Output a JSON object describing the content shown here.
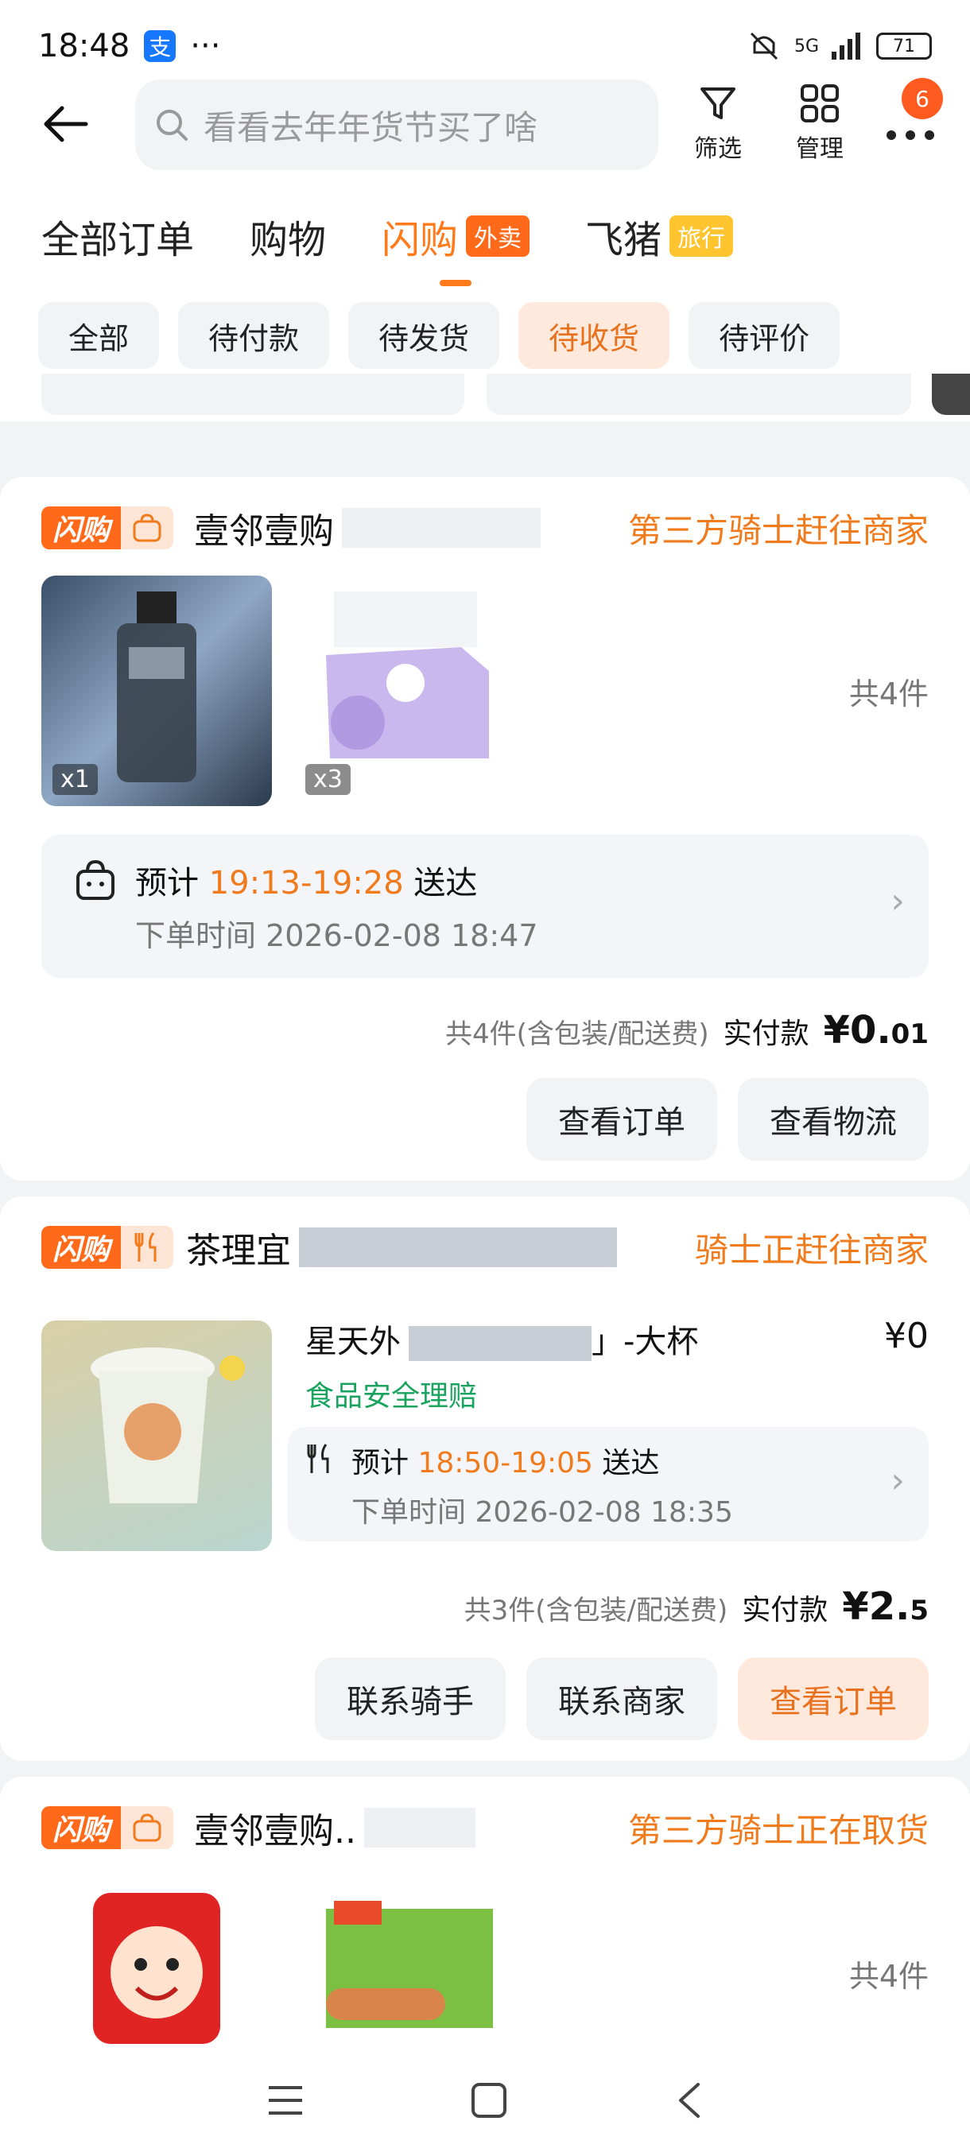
{
  "status_bar": {
    "time": "18:48",
    "dots": "···",
    "network": "5G",
    "battery": "71"
  },
  "header": {
    "search_placeholder": "看看去年年货节买了啥",
    "filter_label": "筛选",
    "manage_label": "管理",
    "more_badge": "6"
  },
  "tabs": [
    {
      "label": "全部订单",
      "tag": ""
    },
    {
      "label": "购物",
      "tag": ""
    },
    {
      "label": "闪购",
      "tag": "外卖"
    },
    {
      "label": "飞猪",
      "tag": "旅行"
    }
  ],
  "filters": [
    "全部",
    "待付款",
    "待发货",
    "待收货",
    "待评价"
  ],
  "active_filter": "待收货",
  "orders": [
    {
      "brand": "闪购",
      "shop": "壹邻壹购",
      "status": "第三方骑士赶往商家",
      "items": [
        {
          "qty": "x1",
          "icon": "lotion-bottle"
        },
        {
          "qty": "x3",
          "icon": "tissue-box"
        }
      ],
      "count": "共4件",
      "eta_prefix": "预计",
      "eta_time": "19:13-19:28",
      "eta_suffix": "送达",
      "order_time": "下单时间 2026-02-08 18:47",
      "summary": "共4件(含包装/配送费)",
      "paid_label": "实付款",
      "amount_main": "¥0.",
      "amount_dec": "01",
      "buttons": [
        "查看订单",
        "查看物流"
      ]
    },
    {
      "brand": "闪购",
      "shop": "茶理宜",
      "status": "骑士正赶往商家",
      "product_title": "星天外",
      "product_title_tail": "」-大杯",
      "price": "¥0",
      "safety": "食品安全理赔",
      "eta_prefix": "预计",
      "eta_time": "18:50-19:05",
      "eta_suffix": "送达",
      "order_time": "下单时间 2026-02-08 18:35",
      "summary": "共3件(含包装/配送费)",
      "paid_label": "实付款",
      "amount_main": "¥2.",
      "amount_dec": "5",
      "buttons": [
        "联系骑手",
        "联系商家",
        "查看订单"
      ]
    },
    {
      "brand": "闪购",
      "shop": "壹邻壹购..",
      "status": "第三方骑士正在取货",
      "count": "共4件"
    }
  ],
  "colors": {
    "accent": "#f07b1d",
    "brand_orange": "#ff6a1a",
    "safety_green": "#1aa35f"
  }
}
